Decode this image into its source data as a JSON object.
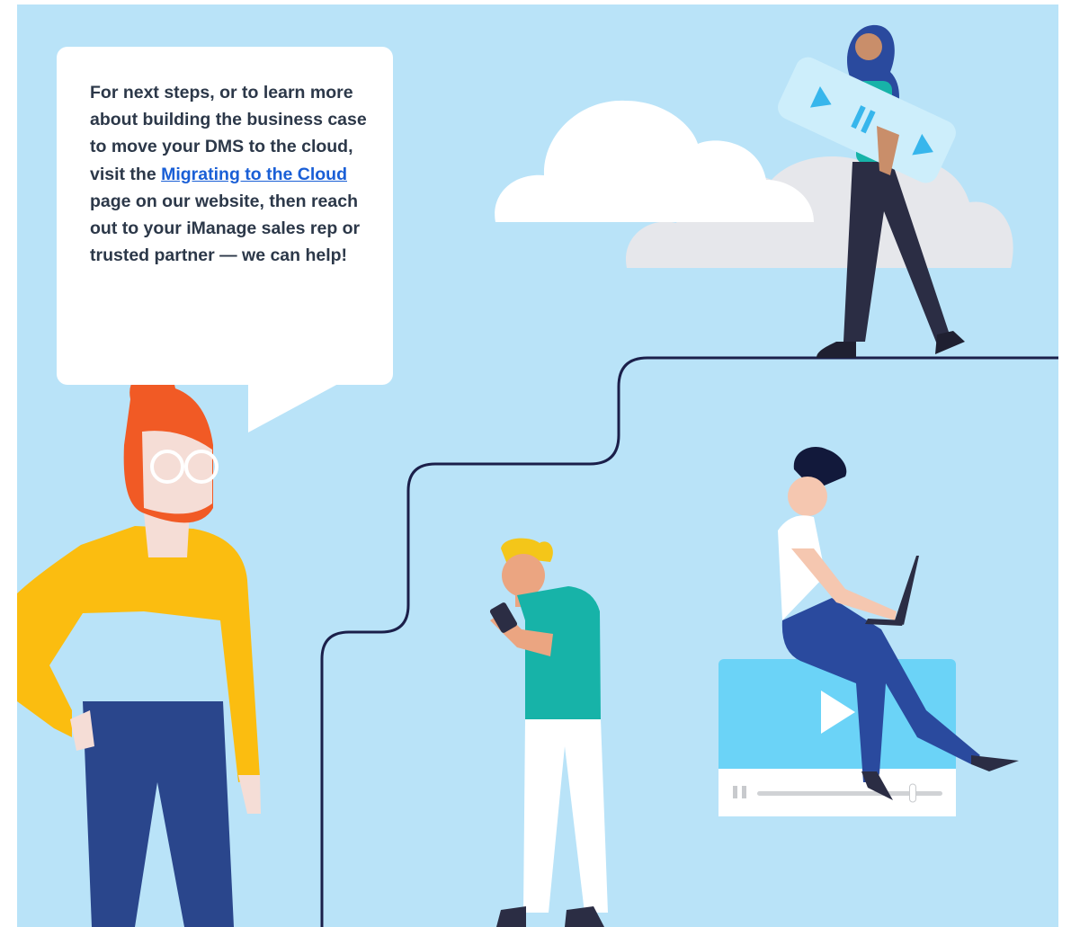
{
  "callout": {
    "text_before": "For next steps, or to learn more about building the business case to move your DMS to the cloud, visit the ",
    "link_label": "Migrating to the Cloud",
    "text_after": " page on our website, then reach out to your iManage sales rep or trusted partner — we can help!"
  },
  "colors": {
    "background": "#b9e3f8",
    "bubble": "#ffffff",
    "text": "#2c3849",
    "link": "#1a5fd6",
    "path_line": "#1b1f4a",
    "cloud_front": "#ffffff",
    "cloud_back": "#e6e7eb",
    "video_panel": "#6bd3f7"
  },
  "icons": {
    "video_play": "play-icon",
    "video_pause": "pause-icon",
    "carried_play": "play-icon",
    "carried_pause": "pause-icon"
  },
  "video_player": {
    "progress": 0.84
  }
}
